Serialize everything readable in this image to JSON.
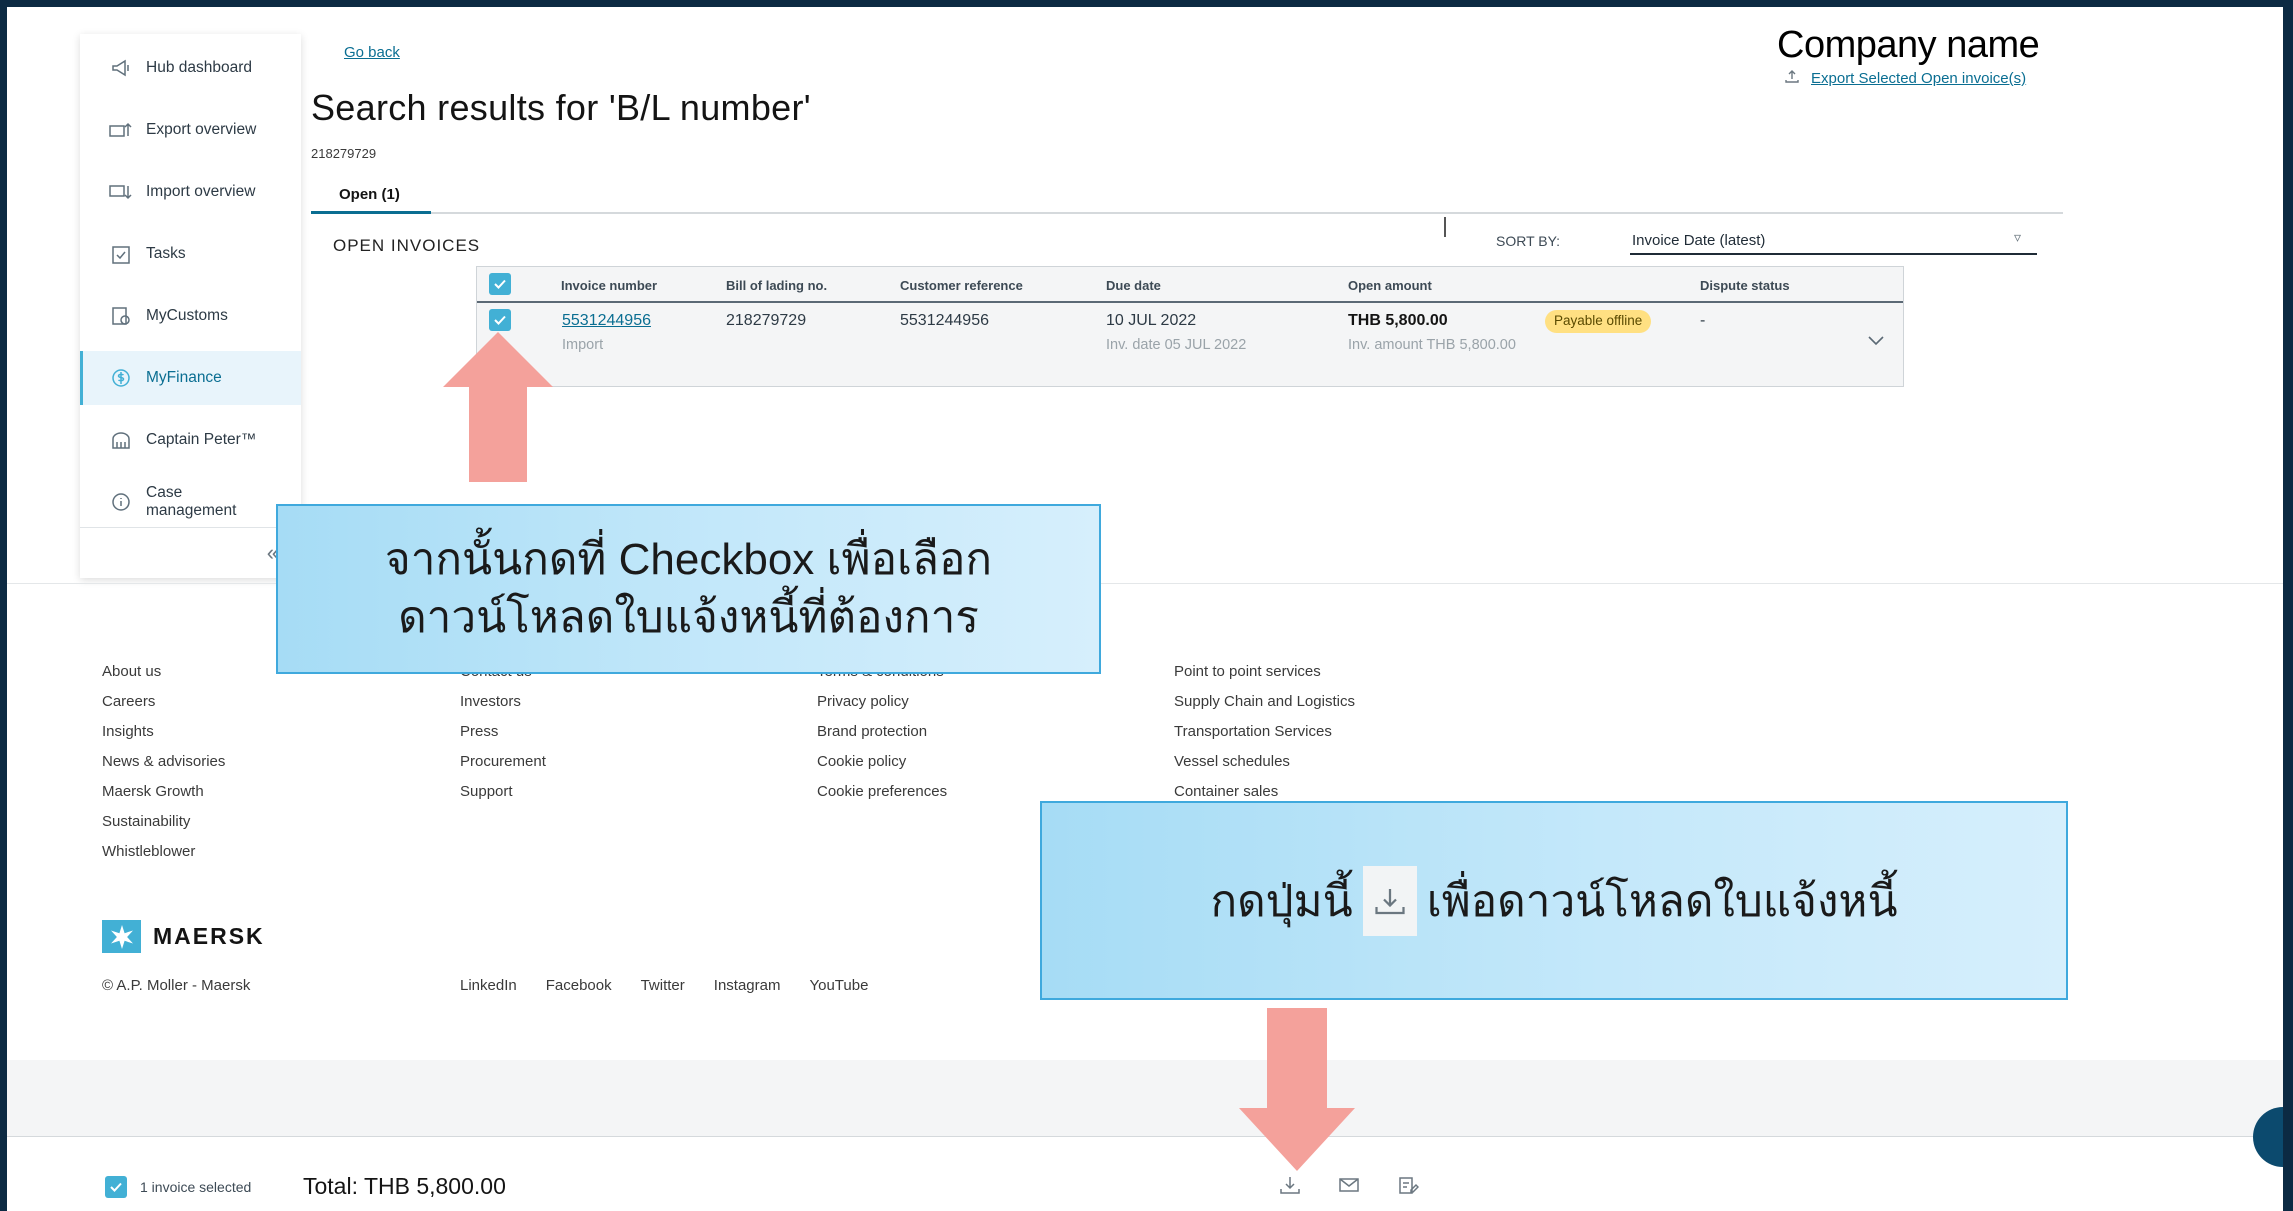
{
  "header": {
    "go_back": "Go back",
    "company": "Company name",
    "export_link": "Export Selected Open invoice(s)",
    "title": "Search results for 'B/L number'",
    "bl_number": "218279729"
  },
  "sidebar": {
    "items": [
      {
        "label": "Hub dashboard",
        "icon": "megaphone-icon"
      },
      {
        "label": "Export overview",
        "icon": "export-icon"
      },
      {
        "label": "Import overview",
        "icon": "import-icon"
      },
      {
        "label": "Tasks",
        "icon": "tasks-icon"
      },
      {
        "label": "MyCustoms",
        "icon": "customs-icon"
      },
      {
        "label": "MyFinance",
        "icon": "finance-icon",
        "active": true
      },
      {
        "label": "Captain Peter™",
        "icon": "captain-peter-icon"
      },
      {
        "label": "Case\nmanagement",
        "icon": "info-icon"
      }
    ],
    "collapse": "«"
  },
  "tabs": [
    {
      "label": "Open (1)",
      "selected": true
    }
  ],
  "section_title": "OPEN INVOICES",
  "sort": {
    "label": "SORT BY:",
    "value": "Invoice Date (latest)"
  },
  "table": {
    "columns": [
      "Invoice number",
      "Bill of lading no.",
      "Customer reference",
      "Due date",
      "Open amount",
      "Dispute status"
    ],
    "rows": [
      {
        "invoice_number": "5531244956",
        "type": "Import",
        "bill_of_lading": "218279729",
        "customer_reference": "5531244956",
        "due_date": "10 JUL 2022",
        "inv_date": "Inv. date 05 JUL 2022",
        "open_amount": "THB 5,800.00",
        "inv_amount": "Inv. amount THB 5,800.00",
        "badge": "Payable offline",
        "dispute_status": "-",
        "checked": true
      }
    ]
  },
  "callouts": {
    "first_line1": "จากนั้นกดที่ Checkbox เพื่อเลือก",
    "first_line2": "ดาวน์โหลดใบแจ้งหนี้ที่ต้องการ",
    "second_before": "กดปุ่มนี้",
    "second_after": "เพื่อดาวน์โหลดใบแจ้งหนี้"
  },
  "footer": {
    "col1": [
      "About us",
      "Careers",
      "Insights",
      "News & advisories",
      "Maersk Growth",
      "Sustainability",
      "Whistleblower"
    ],
    "col2": [
      "Contact us",
      "Investors",
      "Press",
      "Procurement",
      "Support"
    ],
    "col3": [
      "Terms & conditions",
      "Privacy policy",
      "Brand protection",
      "Cookie policy",
      "Cookie preferences"
    ],
    "col4": [
      "Point to point services",
      "Supply Chain and Logistics",
      "Transportation Services",
      "Vessel schedules",
      "Container sales"
    ],
    "logo_text": "MAERSK",
    "copyright": "© A.P. Moller - Maersk",
    "social": [
      "LinkedIn",
      "Facebook",
      "Twitter",
      "Instagram",
      "YouTube"
    ]
  },
  "bottom_bar": {
    "selected_text": "1 invoice selected",
    "total": "Total: THB 5,800.00"
  },
  "colors": {
    "accent": "#42b0d5",
    "link": "#0a6e92",
    "arrow": "#f4a19b",
    "callout_border": "#3fa9dd",
    "badge": "#ffe082"
  }
}
